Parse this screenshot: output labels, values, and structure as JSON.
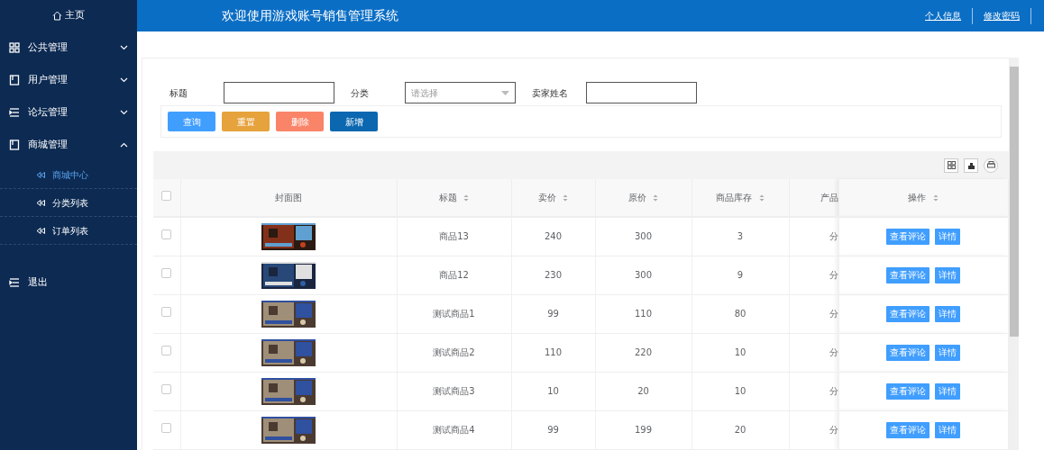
{
  "header": {
    "title": "欢迎使用游戏账号销售管理系统",
    "links": [
      "个人信息",
      "修改密码"
    ]
  },
  "sidebar": {
    "home": "主页",
    "items": [
      {
        "label": "公共管理",
        "expanded": false
      },
      {
        "label": "用户管理",
        "expanded": false
      },
      {
        "label": "论坛管理",
        "expanded": false
      },
      {
        "label": "商城管理",
        "expanded": true,
        "children": [
          {
            "label": "商城中心",
            "selected": true
          },
          {
            "label": "分类列表",
            "selected": false
          },
          {
            "label": "订单列表",
            "selected": false
          }
        ]
      },
      {
        "label": "退出"
      }
    ]
  },
  "search": {
    "fields": [
      {
        "label": "标题",
        "kind": "text"
      },
      {
        "label": "分类",
        "kind": "select",
        "placeholder": "请选择"
      },
      {
        "label": "卖家姓名",
        "kind": "text"
      }
    ],
    "buttons": [
      {
        "label": "查询",
        "kind": "query"
      },
      {
        "label": "重置",
        "kind": "reset"
      },
      {
        "label": "删除",
        "kind": "delete"
      },
      {
        "label": "新增",
        "kind": "add"
      }
    ]
  },
  "table": {
    "select_all": {
      "checked": false
    },
    "columns": [
      {
        "label": "封面图",
        "sortable": false
      },
      {
        "label": "标题",
        "sortable": true
      },
      {
        "label": "卖价",
        "sortable": true
      },
      {
        "label": "原价",
        "sortable": true
      },
      {
        "label": "商品库存",
        "sortable": true
      },
      {
        "label": "产品",
        "sortable": false
      },
      {
        "label": "操作",
        "sortable": true
      }
    ],
    "rows": [
      {
        "cover": {
          "kind": "picture"
        },
        "title": "商品13",
        "price": "240",
        "original": "300",
        "stock": "3",
        "category": "分",
        "checked": false,
        "actions": [
          "查看评论",
          "详情"
        ]
      },
      {
        "cover": {
          "kind": "picture"
        },
        "title": "商品12",
        "price": "230",
        "original": "300",
        "stock": "9",
        "category": "分",
        "checked": false,
        "actions": [
          "查看评论",
          "详情"
        ]
      },
      {
        "cover": {
          "kind": "picture"
        },
        "title": "测试商品1",
        "price": "99",
        "original": "110",
        "stock": "80",
        "category": "分",
        "checked": false,
        "actions": [
          "查看评论",
          "详情"
        ]
      },
      {
        "cover": {
          "kind": "picture"
        },
        "title": "测试商品2",
        "price": "110",
        "original": "220",
        "stock": "10",
        "category": "分",
        "checked": false,
        "actions": [
          "查看评论",
          "详情"
        ]
      },
      {
        "cover": {
          "kind": "picture"
        },
        "title": "测试商品3",
        "price": "10",
        "original": "20",
        "stock": "10",
        "category": "分",
        "checked": false,
        "actions": [
          "查看评论",
          "详情"
        ]
      },
      {
        "cover": {
          "kind": "picture"
        },
        "title": "测试商品4",
        "price": "99",
        "original": "199",
        "stock": "20",
        "category": "分",
        "checked": false,
        "actions": [
          "查看评论",
          "详情"
        ]
      }
    ]
  }
}
